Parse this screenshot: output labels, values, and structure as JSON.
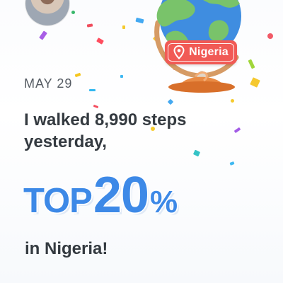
{
  "header": {
    "location_tag": "Nigeria"
  },
  "content": {
    "date": "MAY 29",
    "headline": "I walked 8,990 steps yesterday,",
    "rank_prefix": "TOP",
    "rank_value": "20",
    "rank_unit": "%",
    "location_line": "in Nigeria!"
  },
  "colors": {
    "accent_blue": "#3d89e7",
    "tag_red": "#f15a55",
    "globe_ocean": "#3f8de0",
    "globe_land": "#79c36a",
    "stand_orange": "#e98b45",
    "text_dark": "#343a40"
  },
  "icons": {
    "avatar": "avatar",
    "globe": "globe-icon",
    "location": "map-pin-icon"
  }
}
